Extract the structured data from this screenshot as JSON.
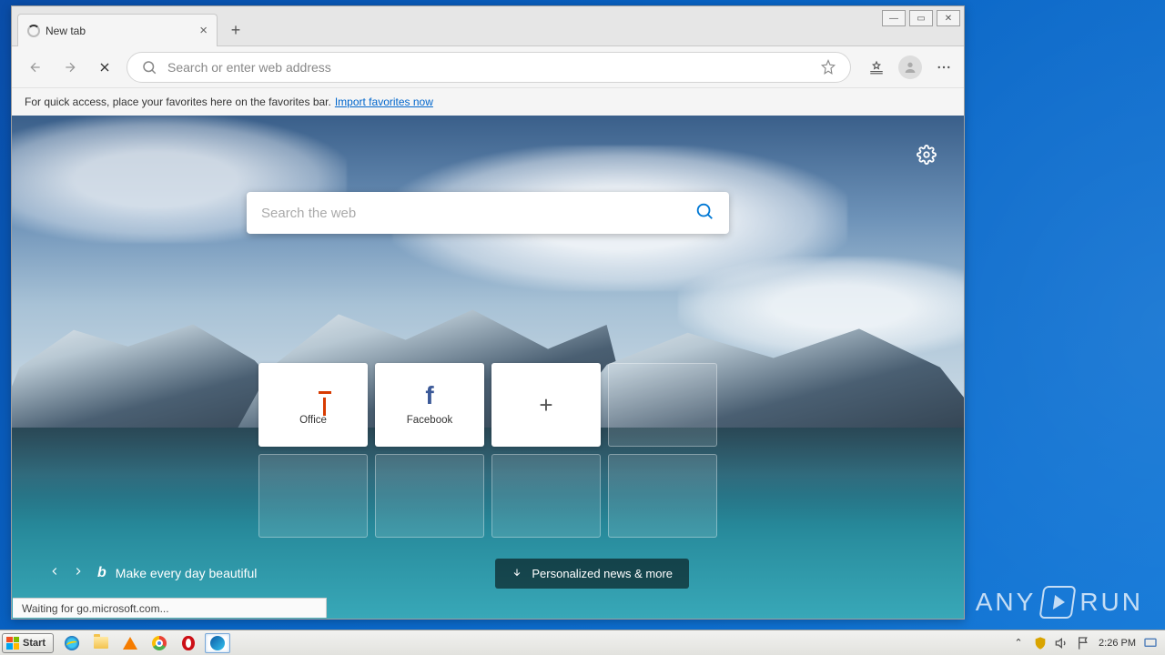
{
  "browser": {
    "tab": {
      "title": "New tab"
    },
    "omnibox_placeholder": "Search or enter web address",
    "favorites_hint": "For quick access, place your favorites here on the favorites bar.",
    "import_link": "Import favorites now",
    "status": "Waiting for go.microsoft.com..."
  },
  "ntp": {
    "search_placeholder": "Search the web",
    "tiles": [
      {
        "label": "Office"
      },
      {
        "label": "Facebook"
      }
    ],
    "tagline": "Make every day beautiful",
    "news_button": "Personalized news & more"
  },
  "taskbar": {
    "start": "Start",
    "time": "2:26 PM"
  },
  "watermark": {
    "brand": "ANY",
    "brand2": "RUN"
  }
}
